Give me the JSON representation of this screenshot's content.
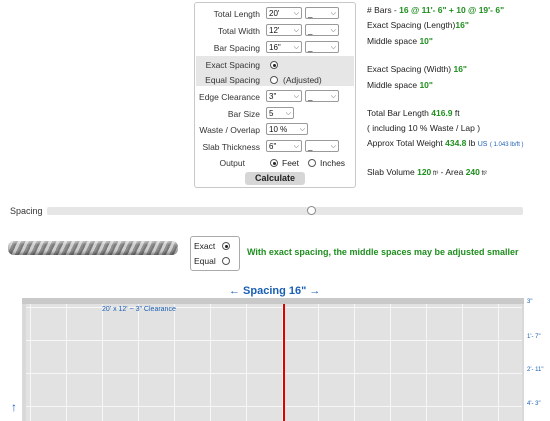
{
  "form": {
    "total_length": {
      "label": "Total Length",
      "feet": "20'",
      "inches": "_"
    },
    "total_width": {
      "label": "Total Width",
      "feet": "12'",
      "inches": "_"
    },
    "bar_spacing": {
      "label": "Bar Spacing",
      "feet": "16\"",
      "inches": "_"
    },
    "exact_spacing": {
      "label": "Exact Spacing"
    },
    "equal_spacing": {
      "label": "Equal Spacing",
      "note": "(Adjusted)"
    },
    "edge_clearance": {
      "label": "Edge Clearance",
      "feet": "3\"",
      "inches": "_"
    },
    "bar_size": {
      "label": "Bar Size",
      "value": "5"
    },
    "waste": {
      "label": "Waste / Overlap",
      "value": "10 %"
    },
    "slab_thickness": {
      "label": "Slab Thickness",
      "feet": "6\"",
      "inches": "_"
    },
    "output": {
      "label": "Output",
      "opt1": "Feet",
      "opt2": "Inches"
    },
    "calculate": "Calculate"
  },
  "results": {
    "bars_prefix": "# Bars - ",
    "bars_value": "16 @ 11'- 6\" + 10 @ 19'- 6\"",
    "exact_len_prefix": "Exact Spacing ",
    "exact_len_unit": "(Length)",
    "exact_len_value": "16\"",
    "middle_label": "Middle space ",
    "middle_len_value": "10\"",
    "exact_wid_prefix": "Exact Spacing ",
    "exact_wid_unit": "(Width)",
    "exact_wid_value": "16\"",
    "middle_wid_value": "10\"",
    "total_bar_prefix": "Total Bar Length ",
    "total_bar_value": "416.9",
    "total_bar_unit": " ft",
    "including": "( including 10 % Waste / Lap )",
    "weight_prefix": "Approx Total Weight ",
    "weight_value": "434.8",
    "weight_unit": " lb ",
    "weight_us": "US",
    "weight_rate": "( 1.043 lb/ft )",
    "volume_prefix": "Slab Volume ",
    "volume_value": "120",
    "volume_unit": " ft³",
    "area_prefix": " - Area ",
    "area_value": "240",
    "area_unit": " ft²"
  },
  "spacing_slider": {
    "label": "Spacing"
  },
  "spacing_mode": {
    "exact": "Exact",
    "equal": "Equal"
  },
  "note": "With exact spacing, the middle spaces may be adjusted smaller",
  "drawing": {
    "header": "← Spacing 16\" →",
    "caption": "20' x 12' ~ 3\" Clearance",
    "ruler": [
      "3\"",
      "1'- 7\"",
      "2'- 11\"",
      "4'- 3\""
    ],
    "arrow": "↑"
  },
  "colors": {
    "accent_green": "#1f8f1f",
    "ruler_blue": "#1a5fb4",
    "bar_red": "#e00000"
  }
}
